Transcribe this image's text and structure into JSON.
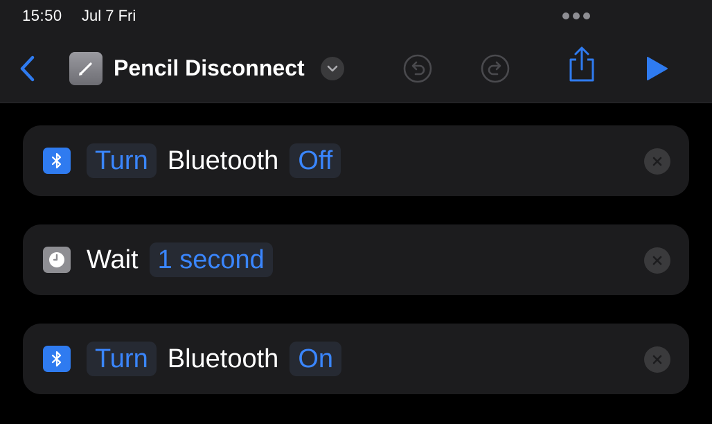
{
  "status_bar": {
    "time": "15:50",
    "date": "Jul 7 Fri"
  },
  "header": {
    "title": "Pencil Disconnect",
    "icons": {
      "back": "chevron-left-icon",
      "app": "pencil-icon",
      "title_menu": "chevron-down-icon",
      "undo": "undo-icon",
      "redo": "redo-icon",
      "share": "share-icon",
      "run": "play-icon"
    }
  },
  "colors": {
    "accent": "#2f7bf0",
    "token_text": "#3a86ff",
    "card_bg": "#1c1c1e",
    "background": "#000000"
  },
  "actions": [
    {
      "icon": "bluetooth-icon",
      "verb": "Turn",
      "noun": "Bluetooth",
      "value": "Off"
    },
    {
      "icon": "clock-icon",
      "verb": "Wait",
      "value": "1 second"
    },
    {
      "icon": "bluetooth-icon",
      "verb": "Turn",
      "noun": "Bluetooth",
      "value": "On"
    }
  ]
}
